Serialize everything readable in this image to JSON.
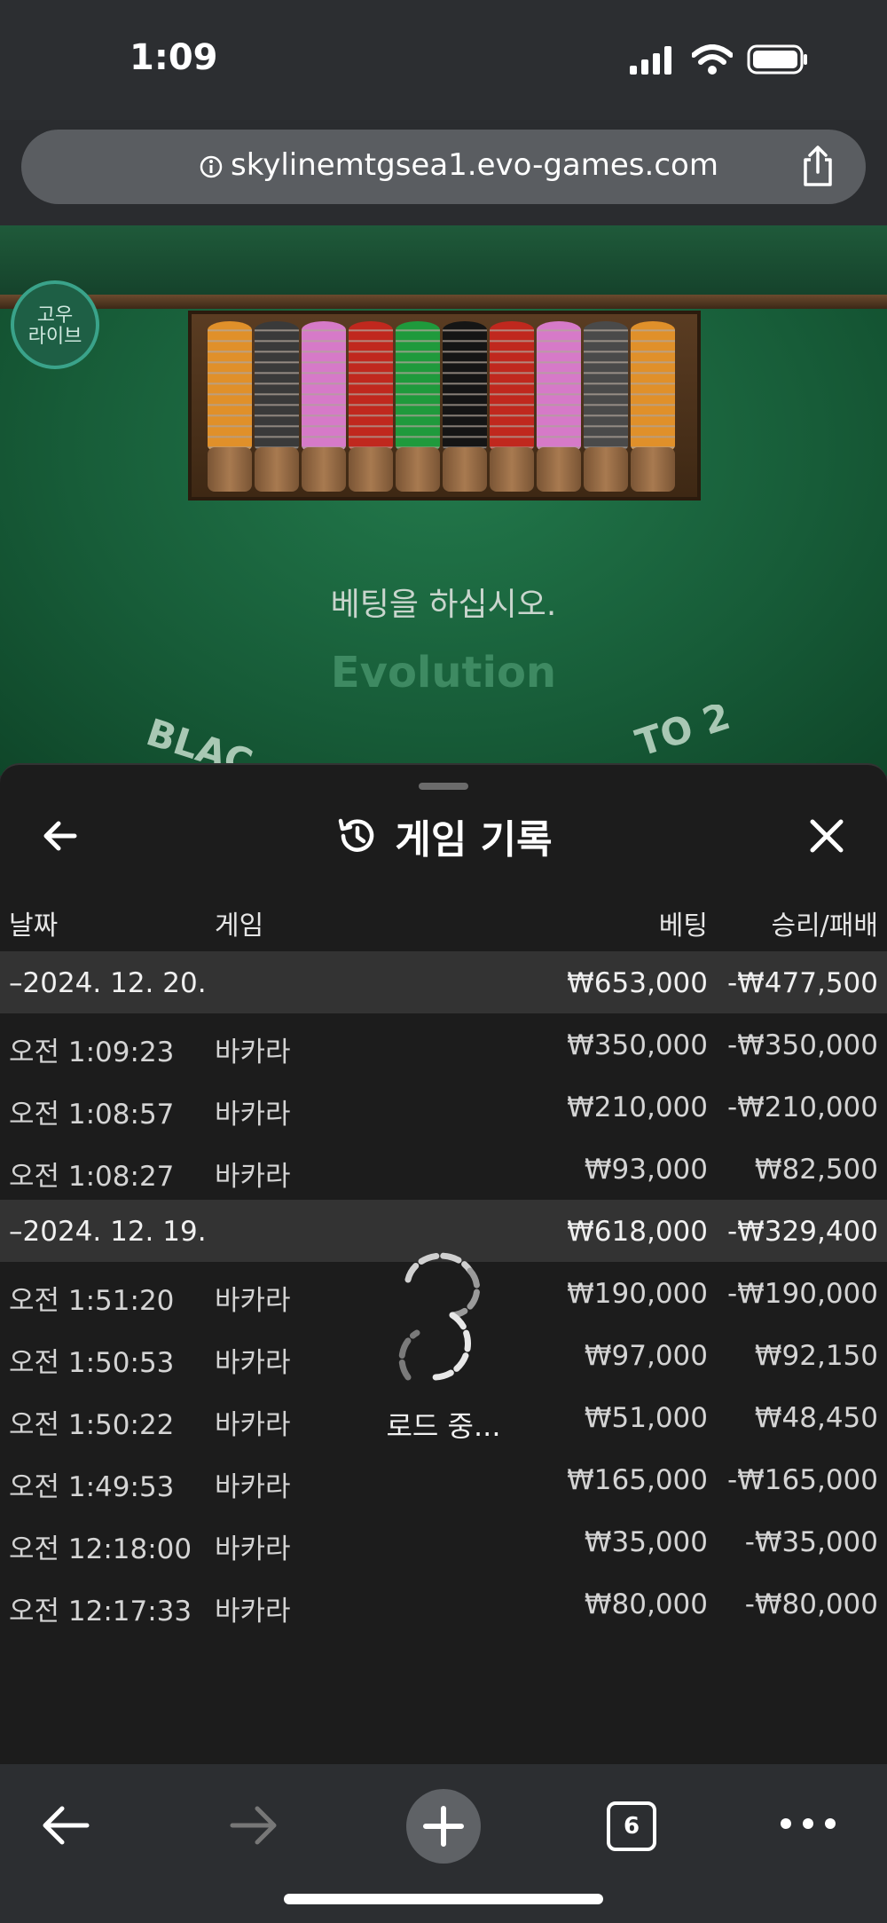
{
  "status_bar": {
    "time": "1:09"
  },
  "browser": {
    "url": "skylinemtgsea1.evo-games.com",
    "tab_count": "6"
  },
  "game": {
    "brand_badge_line1": "고우",
    "brand_badge_line2": "라이브",
    "prompt": "베팅을 하십시오.",
    "provider_logo": "Evolution",
    "table_arc_left": "BLAC",
    "table_arc_right": "TO 2"
  },
  "history_panel": {
    "title": "게임 기록",
    "columns": {
      "date": "날짜",
      "game": "게임",
      "bet": "베팅",
      "win_loss": "승리/패배"
    },
    "rows": [
      {
        "type": "group",
        "date": "–2024. 12. 20.",
        "game": "",
        "bet": "₩653,000",
        "win_loss": "-₩477,500"
      },
      {
        "type": "item",
        "date": "오전 1:09:23",
        "game": "바카라",
        "bet": "₩350,000",
        "win_loss": "-₩350,000"
      },
      {
        "type": "item",
        "date": "오전 1:08:57",
        "game": "바카라",
        "bet": "₩210,000",
        "win_loss": "-₩210,000"
      },
      {
        "type": "item",
        "date": "오전 1:08:27",
        "game": "바카라",
        "bet": "₩93,000",
        "win_loss": "₩82,500"
      },
      {
        "type": "group",
        "date": "–2024. 12. 19.",
        "game": "",
        "bet": "₩618,000",
        "win_loss": "-₩329,400"
      },
      {
        "type": "item",
        "date": "오전 1:51:20",
        "game": "바카라",
        "bet": "₩190,000",
        "win_loss": "-₩190,000"
      },
      {
        "type": "item",
        "date": "오전 1:50:53",
        "game": "바카라",
        "bet": "₩97,000",
        "win_loss": "₩92,150"
      },
      {
        "type": "item",
        "date": "오전 1:50:22",
        "game": "바카라",
        "bet": "₩51,000",
        "win_loss": "₩48,450"
      },
      {
        "type": "item",
        "date": "오전 1:49:53",
        "game": "바카라",
        "bet": "₩165,000",
        "win_loss": "-₩165,000"
      },
      {
        "type": "item",
        "date": "오전 12:18:00",
        "game": "바카라",
        "bet": "₩35,000",
        "win_loss": "-₩35,000"
      },
      {
        "type": "item",
        "date": "오전 12:17:33",
        "game": "바카라",
        "bet": "₩80,000",
        "win_loss": "-₩80,000"
      }
    ],
    "loading_text": "로드 중..."
  },
  "chips": [
    {
      "color": "#e0902a"
    },
    {
      "color": "#3a3a3a"
    },
    {
      "color": "#d67ac8"
    },
    {
      "color": "#c0281e"
    },
    {
      "color": "#1f9a3c"
    },
    {
      "color": "#151515"
    },
    {
      "color": "#c0281e"
    },
    {
      "color": "#d67ac8"
    },
    {
      "color": "#4a4a4a"
    },
    {
      "color": "#e0902a"
    }
  ]
}
